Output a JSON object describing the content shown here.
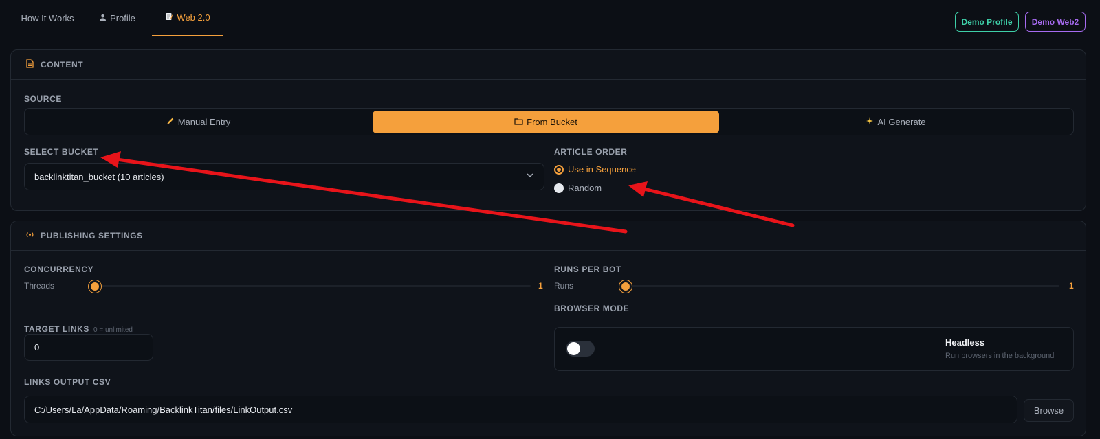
{
  "nav": {
    "tabs": [
      {
        "label": "How It Works",
        "icon": ""
      },
      {
        "label": "Profile",
        "icon": "person-icon"
      },
      {
        "label": "Web 2.0",
        "icon": "memo-icon",
        "active": true
      }
    ],
    "demo_profile": "Demo Profile",
    "demo_web2": "Demo Web2"
  },
  "content": {
    "title": "CONTENT",
    "source_label": "SOURCE",
    "source_options": [
      {
        "label": "Manual Entry",
        "icon": "pencil-icon"
      },
      {
        "label": "From Bucket",
        "icon": "folder-icon",
        "active": true
      },
      {
        "label": "AI Generate",
        "icon": "sparkles-icon"
      }
    ],
    "select_bucket_label": "SELECT BUCKET",
    "bucket_value": "backlinktitan_bucket (10 articles)",
    "article_order_label": "ARTICLE ORDER",
    "order_options": [
      {
        "label": "Use in Sequence",
        "selected": true
      },
      {
        "label": "Random",
        "selected": false
      }
    ]
  },
  "publishing": {
    "title": "PUBLISHING SETTINGS",
    "concurrency_label": "CONCURRENCY",
    "threads_label": "Threads",
    "threads_value": "1",
    "runs_label": "RUNS PER BOT",
    "runs_sub": "Runs",
    "runs_value": "1",
    "browser_mode_label": "BROWSER MODE",
    "headless_title": "Headless",
    "headless_sub": "Run browsers in the background",
    "headless_on": false,
    "target_links_label": "TARGET LINKS",
    "target_links_hint": "0 = unlimited",
    "target_links_value": "0",
    "links_output_label": "LINKS OUTPUT CSV",
    "links_output_value": "C:/Users/La/AppData/Roaming/BacklinkTitan/files/LinkOutput.csv",
    "browse_label": "Browse"
  },
  "colors": {
    "accent": "#f5a03c",
    "demo_profile": "#3ecfa8",
    "demo_web2": "#a66bf0",
    "annotation_arrow": "#e8141a"
  }
}
